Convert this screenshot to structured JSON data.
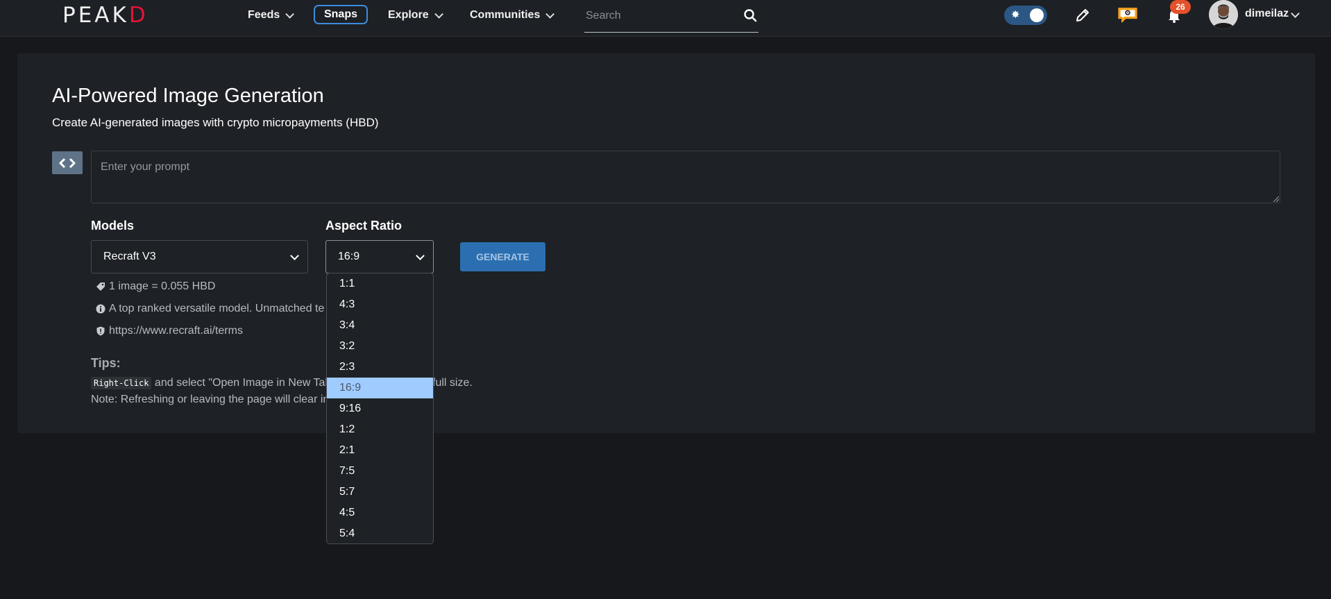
{
  "navbar": {
    "logo_left": "PE",
    "logo_mid": "AK",
    "logo_right": "D",
    "feeds_label": "Feeds",
    "snaps_label": "Snaps",
    "explore_label": "Explore",
    "communities_label": "Communities",
    "search_placeholder": "Search",
    "notification_count": "26",
    "username": "dimeilaz"
  },
  "main": {
    "title": "AI-Powered Image Generation",
    "subtitle": "Create AI-generated images with crypto micropayments (HBD)",
    "prompt_placeholder": "Enter your prompt",
    "prompt_value": "",
    "models_label": "Models",
    "models_selected": "Recraft V3",
    "aspect_label": "Aspect Ratio",
    "aspect_selected": "16:9",
    "generate_label": "GENERATE",
    "price_text": "1 image = 0.055 HBD",
    "model_desc_text": "A top ranked versatile model. Unmatched te",
    "terms_text": "https://www.recraft.ai/terms",
    "tips_title": "Tips:",
    "tip_key": "Right-Click",
    "tip_line1_a": " and select \"Open Image in New Tab",
    "tip_line1_b": "full size.",
    "tip_line2": "Note: Refreshing or leaving the page will clear ima"
  },
  "aspect_options": [
    "1:1",
    "4:3",
    "3:4",
    "3:2",
    "2:3",
    "16:9",
    "9:16",
    "1:2",
    "2:1",
    "7:5",
    "5:7",
    "4:5",
    "5:4"
  ],
  "colors": {
    "accent": "#2b6fb1",
    "brand_red": "#e31337",
    "selected_option": "#9fcbff",
    "badge": "#e4512a"
  },
  "icons": [
    "search-icon",
    "sun-icon",
    "pencil-icon",
    "chat-icon",
    "bell-icon",
    "code-icon",
    "tag-icon",
    "info-icon",
    "shield-icon"
  ]
}
